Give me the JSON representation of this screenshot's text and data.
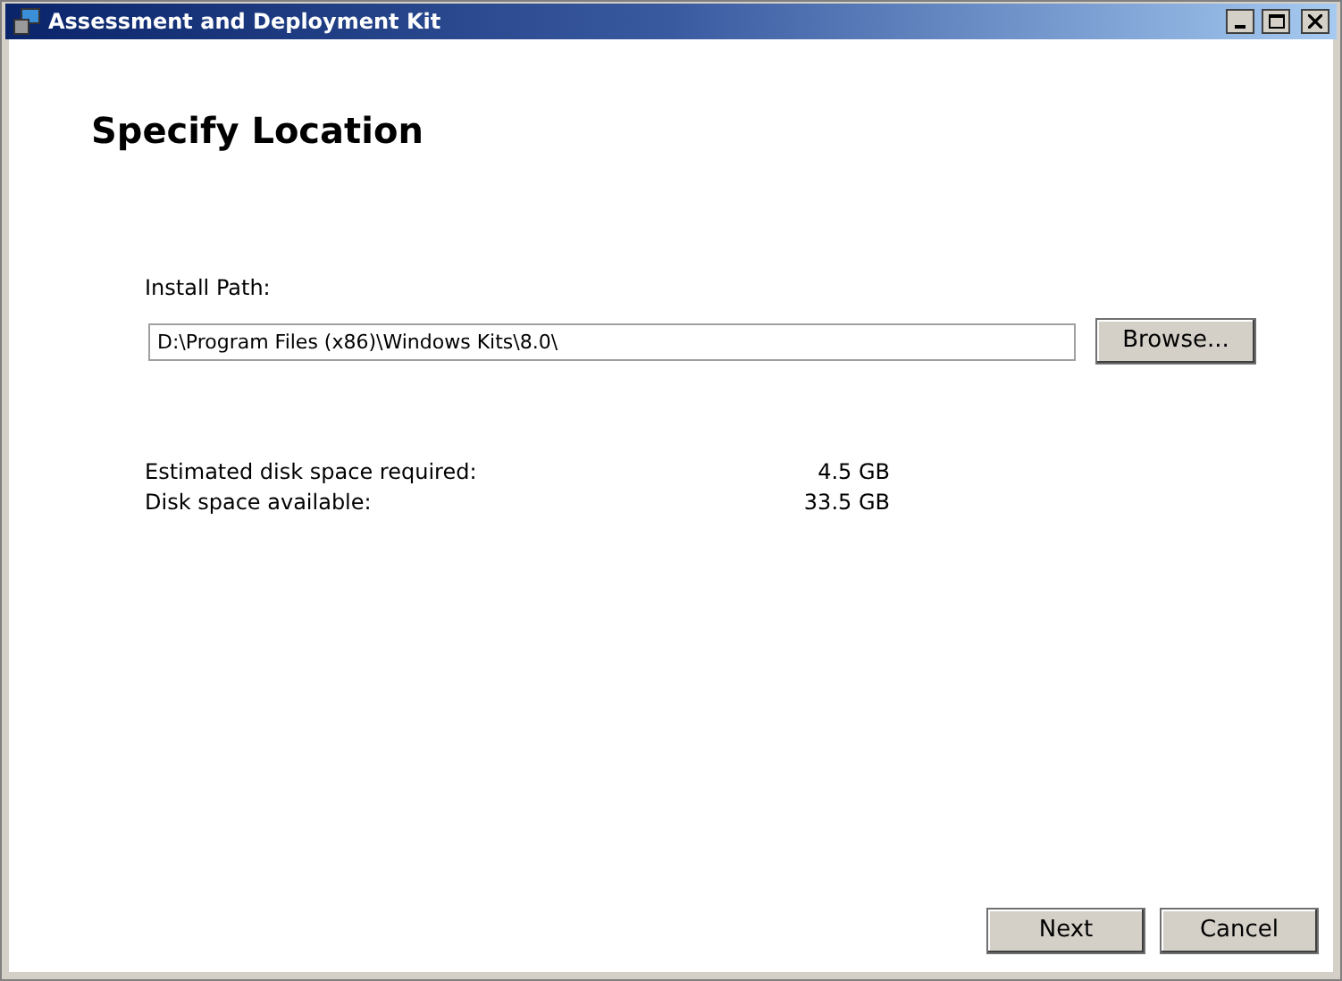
{
  "window": {
    "title": "Assessment and Deployment Kit"
  },
  "heading": "Specify Location",
  "install_path": {
    "label": "Install Path:",
    "value": "D:\\Program Files (x86)\\Windows Kits\\8.0\\",
    "browse_button": "Browse..."
  },
  "disk_info": [
    {
      "label": "Estimated disk space required:",
      "value": "4.5 GB"
    },
    {
      "label": "Disk space available:",
      "value": "33.5 GB"
    }
  ],
  "buttons": [
    "Next",
    "Cancel"
  ]
}
